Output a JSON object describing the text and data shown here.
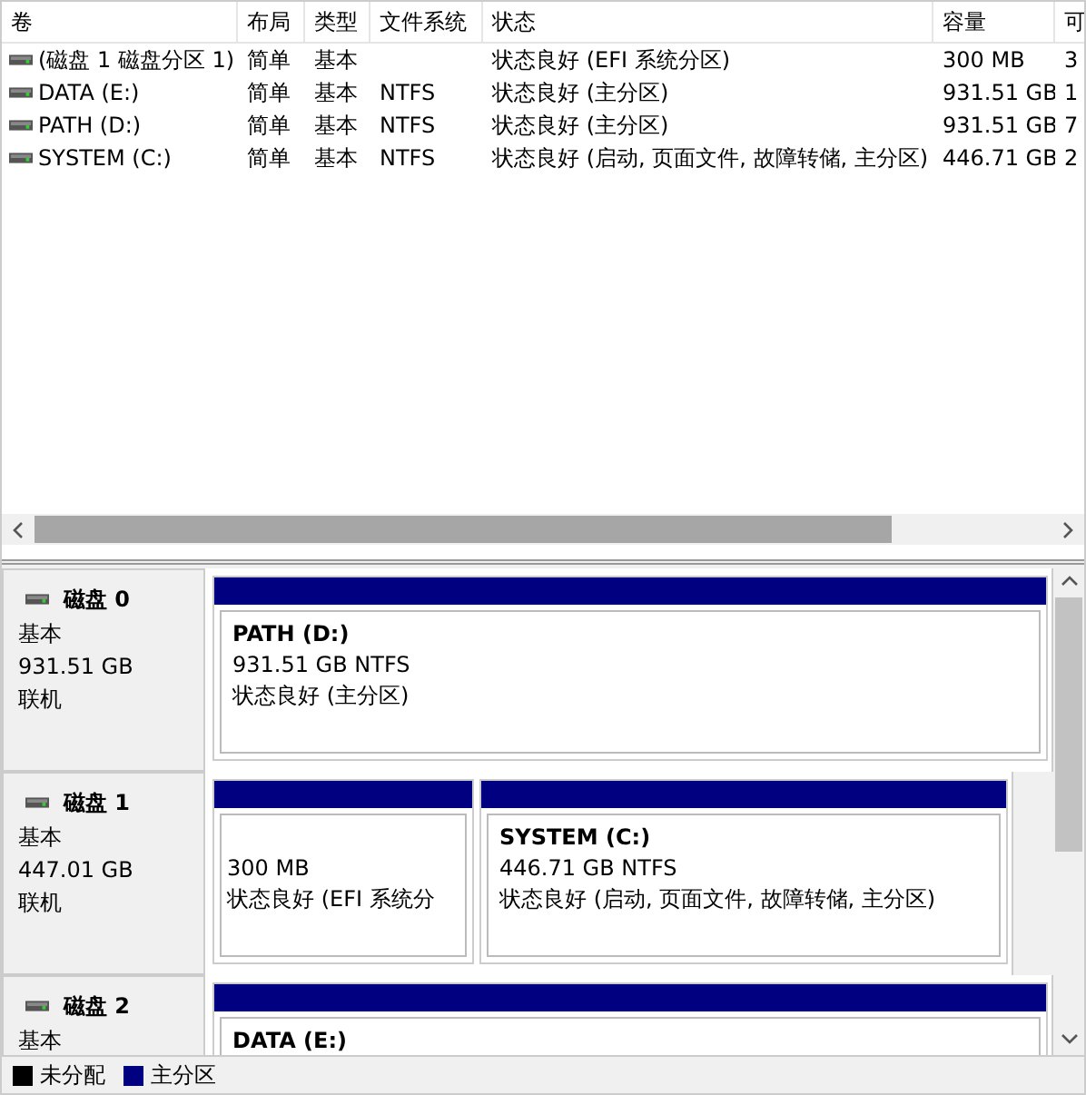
{
  "table": {
    "columns": [
      "卷",
      "布局",
      "类型",
      "文件系统",
      "状态",
      "容量",
      "可"
    ],
    "rows": [
      [
        "(磁盘 1 磁盘分区 1)",
        "简单",
        "基本",
        "",
        "状态良好 (EFI 系统分区)",
        "300 MB",
        "3"
      ],
      [
        "DATA (E:)",
        "简单",
        "基本",
        "NTFS",
        "状态良好 (主分区)",
        "931.51 GB",
        "1"
      ],
      [
        "PATH (D:)",
        "简单",
        "基本",
        "NTFS",
        "状态良好 (主分区)",
        "931.51 GB",
        "7"
      ],
      [
        "SYSTEM (C:)",
        "简单",
        "基本",
        "NTFS",
        "状态良好 (启动, 页面文件, 故障转储, 主分区)",
        "446.71 GB",
        "2"
      ]
    ]
  },
  "disks": [
    {
      "name": "磁盘 0",
      "type": "基本",
      "size": "931.51 GB",
      "status": "联机",
      "partitions": [
        {
          "title": "PATH  (D:)",
          "size": "931.51 GB NTFS",
          "status": "状态良好 (主分区)"
        }
      ]
    },
    {
      "name": "磁盘 1",
      "type": "基本",
      "size": "447.01 GB",
      "status": "联机",
      "partitions": [
        {
          "size": "300 MB",
          "status": "状态良好 (EFI 系统分"
        },
        {
          "title": "SYSTEM  (C:)",
          "size": "446.71 GB NTFS",
          "status": "状态良好 (启动, 页面文件, 故障转储, 主分区)"
        }
      ]
    },
    {
      "name": "磁盘 2",
      "type": "基本",
      "partitions": [
        {
          "title": "DATA  (E:)"
        }
      ]
    }
  ],
  "legend": [
    {
      "label": "未分配",
      "color": "#000000"
    },
    {
      "label": "主分区",
      "color": "#000080"
    }
  ]
}
